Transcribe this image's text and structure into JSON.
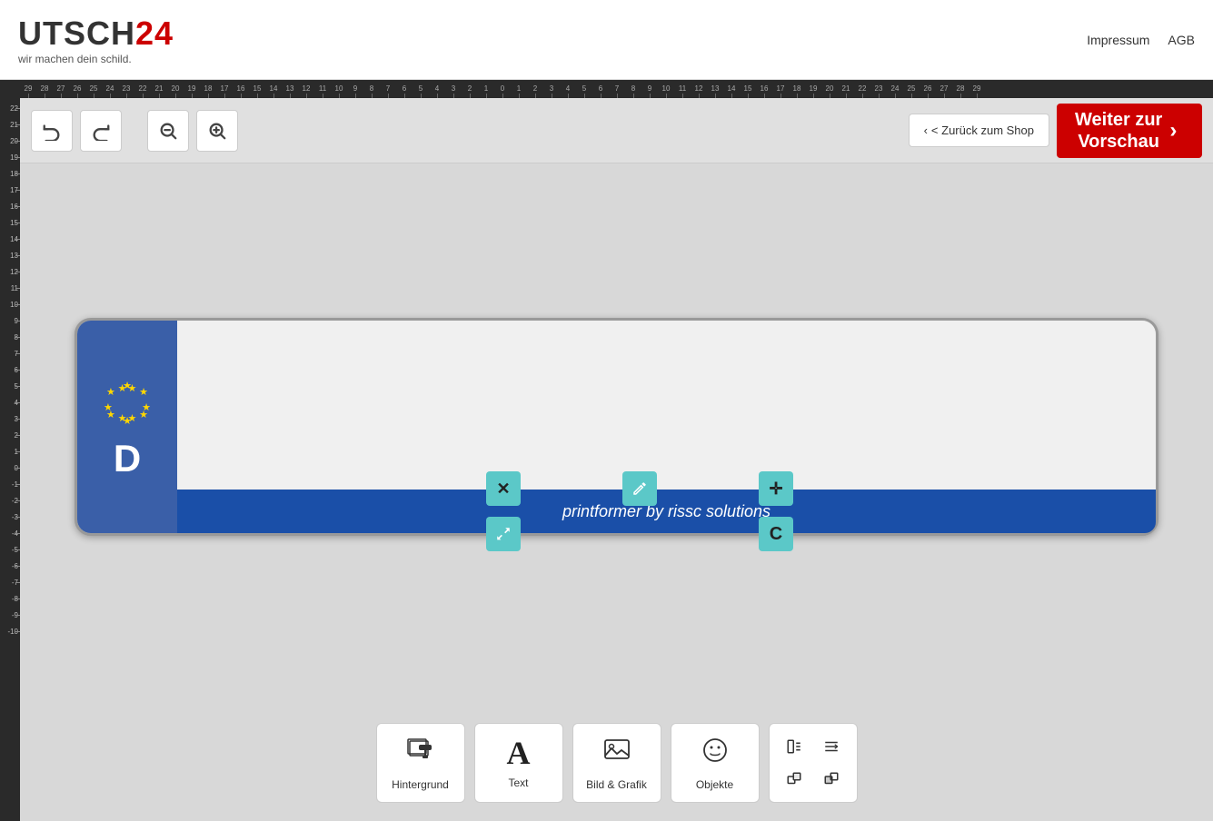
{
  "header": {
    "logo_main": "UTSCH",
    "logo_number": "24",
    "logo_sub": "wir machen dein schild.",
    "link_impressum": "Impressum",
    "link_agb": "AGB"
  },
  "toolbar": {
    "undo_label": "↩",
    "redo_label": "↪",
    "zoom_out_label": "🔍",
    "zoom_in_label": "🔍+",
    "back_to_shop": "< Zurück zum Shop",
    "weiter_label": "Weiter zur\nVorschau",
    "weiter_arrow": "›"
  },
  "ruler": {
    "top_numbers": [
      "-29",
      "-28",
      "-27",
      "-26",
      "-25",
      "-24",
      "-23",
      "-22",
      "-21",
      "-20",
      "-19",
      "-18",
      "-17",
      "-16",
      "-15",
      "-14",
      "-13",
      "-12",
      "-11",
      "-10",
      "-9",
      "-8",
      "-7",
      "-6",
      "-5",
      "-4",
      "-3",
      "-2",
      "-1",
      "0",
      "1",
      "2",
      "3",
      "4",
      "5",
      "6",
      "7",
      "8",
      "9",
      "10",
      "11",
      "12",
      "13",
      "14",
      "15",
      "16",
      "17",
      "18",
      "19",
      "20",
      "21",
      "22",
      "23",
      "24",
      "25",
      "26",
      "27",
      "28",
      "29"
    ],
    "left_numbers": [
      "22",
      "21",
      "20",
      "19",
      "18",
      "17",
      "16",
      "15",
      "14",
      "13",
      "12",
      "11",
      "10",
      "9",
      "8",
      "7",
      "6",
      "5",
      "4",
      "3",
      "2",
      "1",
      "0",
      "-1",
      "-2",
      "-3",
      "-4",
      "-5",
      "-6",
      "-7",
      "-8",
      "-9",
      "-10"
    ]
  },
  "plate": {
    "eu_letter": "D",
    "text": "printformer by rissc solutions",
    "eu_stars_count": 12
  },
  "float_buttons": {
    "delete": "✕",
    "edit": "✏",
    "move": "✛",
    "resize": "⤢",
    "reset": "C"
  },
  "bottom_toolbar": {
    "items": [
      {
        "id": "hintergrund",
        "label": "Hintergrund",
        "icon": "🖌"
      },
      {
        "id": "text",
        "label": "Text",
        "icon": "A"
      },
      {
        "id": "bild_grafik",
        "label": "Bild & Grafik",
        "icon": "🖼"
      },
      {
        "id": "objekte",
        "label": "Objekte",
        "icon": "☺"
      }
    ],
    "last_group": {
      "icons": [
        "⊞",
        "⊡",
        "▣",
        "▢"
      ]
    }
  }
}
